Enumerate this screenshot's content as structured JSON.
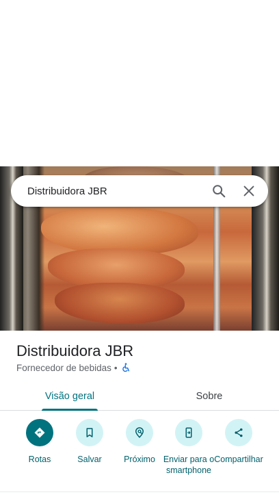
{
  "search": {
    "query": "Distribuidora JBR"
  },
  "place": {
    "title": "Distribuidora JBR",
    "category": "Fornecedor de bebidas",
    "separator": "•",
    "accessibility_icon": "wheelchair-icon"
  },
  "tabs": [
    {
      "label": "Visão geral",
      "active": true
    },
    {
      "label": "Sobre",
      "active": false
    }
  ],
  "actions": [
    {
      "label": "Rotas",
      "icon": "directions-icon"
    },
    {
      "label": "Salvar",
      "icon": "bookmark-icon"
    },
    {
      "label": "Próximo",
      "icon": "nearby-icon"
    },
    {
      "label": "Enviar para o smartphone",
      "icon": "send-to-phone-icon"
    },
    {
      "label": "Compartilhar",
      "icon": "share-icon"
    }
  ],
  "colors": {
    "accent": "#00737f",
    "action_circle": "#d2f3f6",
    "accessibility_blue": "#1a73e8"
  }
}
